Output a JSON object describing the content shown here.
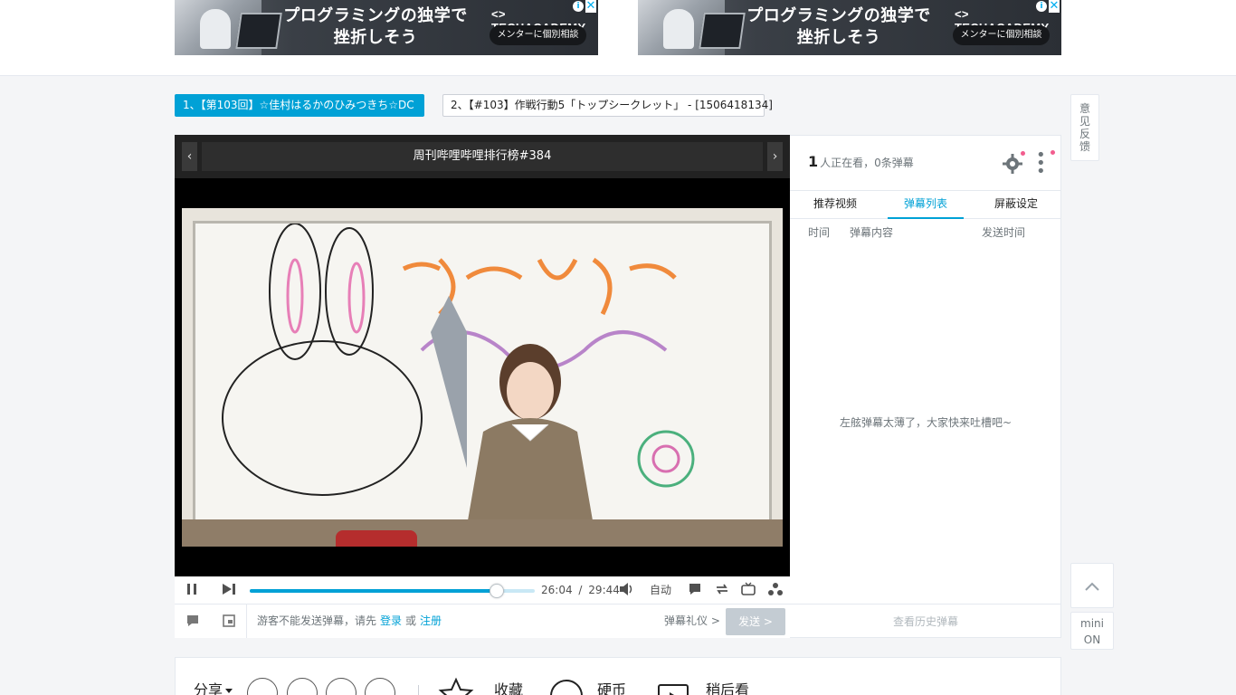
{
  "ads": [
    {
      "headline_line1": "プログラミングの独学で",
      "headline_line2": "挫折しそう",
      "brand": "<> TECHACADEMY",
      "cta": "メンターに個別相談",
      "info": "i",
      "close": "✕"
    },
    {
      "headline_line1": "プログラミングの独学で",
      "headline_line2": "挫折しそう",
      "brand": "<> TECHACADEMY",
      "cta": "メンターに個別相談",
      "info": "i",
      "close": "✕"
    }
  ],
  "parts": [
    {
      "label": "1、【第103回】☆佳村はるかのひみつきち☆DC",
      "active": true
    },
    {
      "label": "2、【#103】作戦行動5「トップシークレット」 - [1506418134]",
      "active": false
    }
  ],
  "feedback": [
    "意",
    "见",
    "反",
    "馈"
  ],
  "back_to_top": "⌃",
  "mini": {
    "line1": "mini",
    "line2": "ON"
  },
  "player": {
    "title": "周刊哔哩哔哩排行榜#384",
    "prev": "‹",
    "next": "›",
    "progress": 0.866,
    "current_time": "26:04",
    "separator": "/",
    "duration": "29:44",
    "quality": "自动"
  },
  "danmaku": {
    "hint_prefix": "游客不能发送弹幕，请先",
    "login": "登录",
    "or": "或",
    "register": "注册",
    "etiquette": "弹幕礼仪 >",
    "send": "发送 >"
  },
  "side": {
    "viewer_count": "1",
    "viewer_text": "人正在看，0条弹幕",
    "more": "⋮",
    "tabs": [
      "推荐视频",
      "弹幕列表",
      "屏蔽设定"
    ],
    "active_tab": 1,
    "columns": [
      "时间",
      "弹幕内容",
      "发送时间"
    ],
    "empty_text": "左舷弹幕太薄了，大家快来吐槽吧~",
    "history": "查看历史弹幕"
  },
  "toolbar": {
    "share": "分享",
    "favorite": "收藏",
    "coin": "硬币",
    "later": "稍后看"
  },
  "colors": {
    "accent": "#00a1d6",
    "notify": "#f25d8e"
  }
}
